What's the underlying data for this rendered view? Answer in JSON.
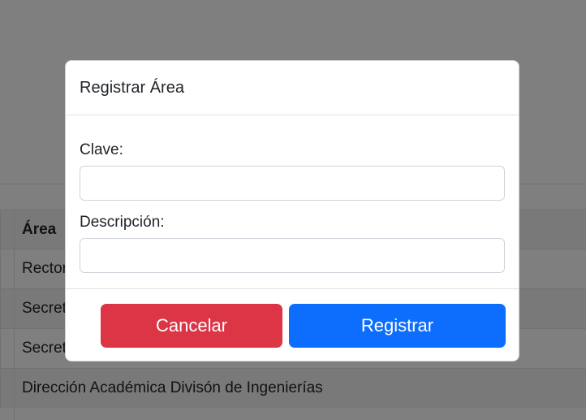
{
  "background": {
    "table": {
      "header": "Área",
      "rows": [
        "Rector",
        "Secret",
        "Secret",
        "Dirección Académica Divisón de Ingenierías"
      ]
    }
  },
  "modal": {
    "title": "Registrar Área",
    "fields": {
      "clave": {
        "label": "Clave:",
        "value": "",
        "placeholder": ""
      },
      "descripcion": {
        "label": "Descripción:",
        "value": "",
        "placeholder": ""
      }
    },
    "buttons": {
      "cancel": "Cancelar",
      "submit": "Registrar"
    }
  },
  "colors": {
    "cancel": "#dc3545",
    "submit": "#0d6efd",
    "backdrop": "rgba(0,0,0,0.5)"
  }
}
